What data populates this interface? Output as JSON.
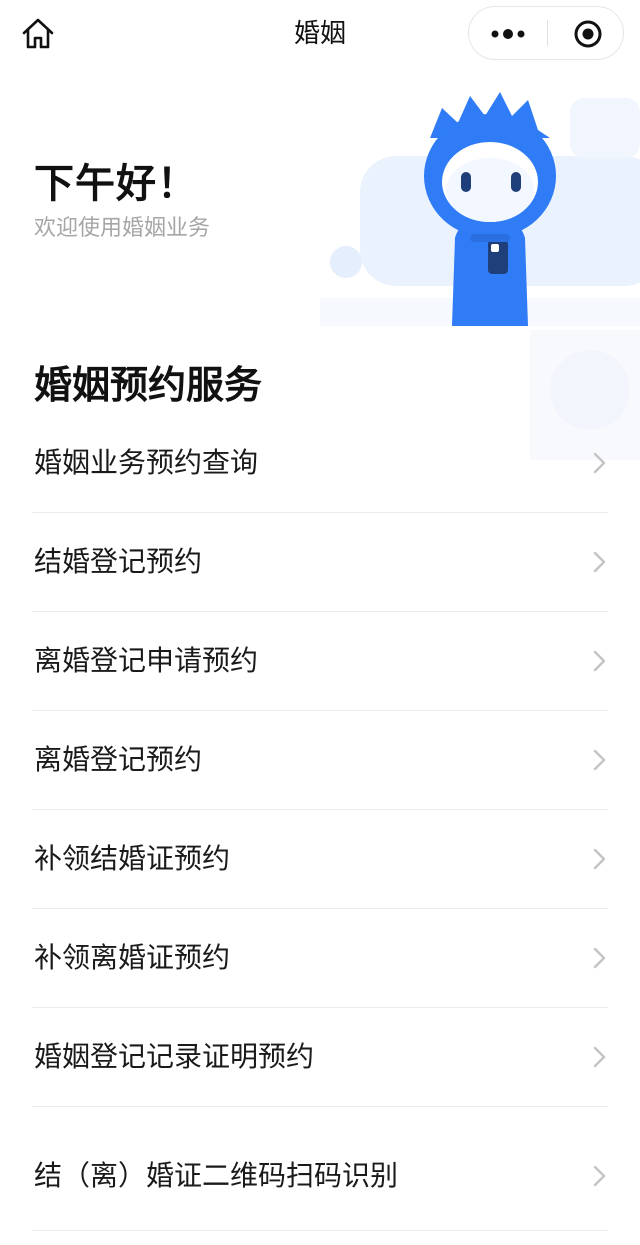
{
  "navbar": {
    "title": "婚姻",
    "home_icon": "home-icon",
    "more_icon": "more-dots-icon",
    "close_icon": "target-close-icon"
  },
  "hero": {
    "greeting": "下午好！",
    "welcome": "欢迎使用婚姻业务",
    "mascot": "mascot-illustration"
  },
  "section": {
    "title": "婚姻预约服务"
  },
  "menu": {
    "items": [
      {
        "label": "婚姻业务预约查询"
      },
      {
        "label": "结婚登记预约"
      },
      {
        "label": "离婚登记申请预约"
      },
      {
        "label": "离婚登记预约"
      },
      {
        "label": "补领结婚证预约"
      },
      {
        "label": "补领离婚证预约"
      },
      {
        "label": "婚姻登记记录证明预约"
      },
      {
        "label": "结（离）婚证二维码扫码识别"
      }
    ]
  },
  "colors": {
    "accent_blue": "#2f7cf6",
    "light_blue_bg": "#e9f2fd",
    "label_gray": "#a6a6a6",
    "chevron_gray": "#c4c4c4"
  }
}
